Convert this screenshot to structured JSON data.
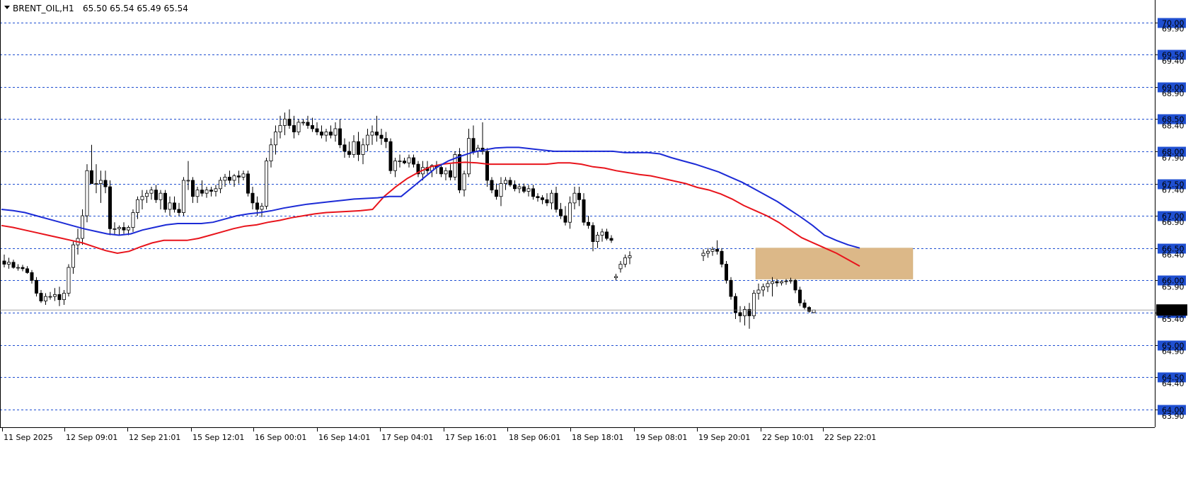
{
  "header": {
    "symbol": "BRENT_OIL,H1",
    "ohlc": "65.50 65.54 65.49 65.54"
  },
  "chart_data": {
    "type": "candlestick",
    "title": "BRENT_OIL,H1  65.50 65.54 65.49 65.54",
    "ylim": [
      63.75,
      70.3
    ],
    "grid": true,
    "grid_style": "dashed",
    "colors": {
      "background": "#ffffff",
      "grid": "#1f4fd1",
      "bull_body": "#ffffff",
      "bear_body": "#000000",
      "wick": "#000000",
      "ma_fast": "#1c2bd6",
      "ma_slow": "#e8141c",
      "zone_fill": "#dcb888",
      "current_price_tag": "#000000"
    },
    "major_levels": [
      "70.00",
      "69.50",
      "69.00",
      "68.50",
      "68.00",
      "67.50",
      "67.00",
      "66.50",
      "66.00",
      "65.50",
      "65.00",
      "64.50",
      "64.00"
    ],
    "minor_levels": [
      "69.90",
      "69.40",
      "68.90",
      "68.40",
      "67.90",
      "67.40",
      "66.90",
      "66.40",
      "65.90",
      "65.40",
      "64.90",
      "64.40",
      "63.90"
    ],
    "current_price": "65.54",
    "x_labels": [
      "11 Sep 2025",
      "12 Sep 09:01",
      "12 Sep 21:01",
      "15 Sep 12:01",
      "16 Sep 00:01",
      "16 Sep 14:01",
      "17 Sep 04:01",
      "17 Sep 16:01",
      "18 Sep 06:01",
      "18 Sep 18:01",
      "19 Sep 08:01",
      "19 Sep 20:01",
      "22 Sep 10:01",
      "22 Sep 22:01"
    ],
    "candles": [
      [
        66.3,
        66.4,
        66.2,
        66.25
      ],
      [
        66.25,
        66.35,
        66.18,
        66.28
      ],
      [
        66.28,
        66.32,
        66.18,
        66.2
      ],
      [
        66.2,
        66.25,
        66.15,
        66.2
      ],
      [
        66.2,
        66.24,
        66.14,
        66.18
      ],
      [
        66.18,
        66.22,
        66.1,
        66.12
      ],
      [
        66.12,
        66.16,
        65.95,
        66.0
      ],
      [
        66.0,
        66.05,
        65.75,
        65.8
      ],
      [
        65.8,
        65.85,
        65.65,
        65.68
      ],
      [
        65.68,
        65.8,
        65.62,
        65.75
      ],
      [
        65.75,
        65.82,
        65.7,
        65.75
      ],
      [
        65.75,
        65.88,
        65.68,
        65.78
      ],
      [
        65.78,
        65.9,
        65.6,
        65.7
      ],
      [
        65.7,
        65.85,
        65.62,
        65.8
      ],
      [
        65.8,
        66.25,
        65.75,
        66.2
      ],
      [
        66.2,
        66.6,
        66.1,
        66.55
      ],
      [
        66.55,
        66.8,
        66.4,
        66.65
      ],
      [
        66.65,
        67.1,
        66.55,
        67.0
      ],
      [
        67.0,
        67.8,
        66.9,
        67.7
      ],
      [
        67.7,
        68.1,
        67.5,
        67.5
      ],
      [
        67.5,
        67.8,
        67.35,
        67.5
      ],
      [
        67.5,
        67.7,
        67.2,
        67.55
      ],
      [
        67.55,
        67.7,
        67.35,
        67.45
      ],
      [
        67.45,
        67.55,
        66.7,
        66.8
      ],
      [
        66.8,
        66.9,
        66.7,
        66.8
      ],
      [
        66.8,
        66.85,
        66.7,
        66.82
      ],
      [
        66.82,
        66.9,
        66.72,
        66.78
      ],
      [
        66.78,
        66.85,
        66.7,
        66.82
      ],
      [
        66.82,
        67.1,
        66.75,
        67.05
      ],
      [
        67.05,
        67.3,
        66.95,
        67.25
      ],
      [
        67.25,
        67.4,
        67.1,
        67.3
      ],
      [
        67.3,
        67.4,
        67.2,
        67.35
      ],
      [
        67.35,
        67.45,
        67.25,
        67.4
      ],
      [
        67.4,
        67.48,
        67.2,
        67.25
      ],
      [
        67.25,
        67.4,
        67.1,
        67.35
      ],
      [
        67.35,
        67.4,
        67.05,
        67.1
      ],
      [
        67.1,
        67.3,
        67.0,
        67.2
      ],
      [
        67.2,
        67.3,
        67.05,
        67.1
      ],
      [
        67.1,
        67.2,
        67.0,
        67.05
      ],
      [
        67.05,
        67.6,
        67.0,
        67.55
      ],
      [
        67.55,
        67.85,
        67.4,
        67.55
      ],
      [
        67.55,
        67.6,
        67.2,
        67.3
      ],
      [
        67.3,
        67.45,
        67.2,
        67.4
      ],
      [
        67.4,
        67.55,
        67.3,
        67.35
      ],
      [
        67.35,
        67.45,
        67.28,
        67.4
      ],
      [
        67.4,
        67.45,
        67.3,
        67.38
      ],
      [
        67.38,
        67.48,
        67.3,
        67.42
      ],
      [
        67.42,
        67.6,
        67.35,
        67.55
      ],
      [
        67.55,
        67.65,
        67.45,
        67.6
      ],
      [
        67.6,
        67.7,
        67.5,
        67.55
      ],
      [
        67.55,
        67.65,
        67.45,
        67.62
      ],
      [
        67.62,
        67.7,
        67.5,
        67.6
      ],
      [
        67.6,
        67.7,
        67.55,
        67.65
      ],
      [
        67.65,
        67.7,
        67.3,
        67.35
      ],
      [
        67.35,
        67.45,
        67.1,
        67.2
      ],
      [
        67.2,
        67.3,
        67.0,
        67.1
      ],
      [
        67.1,
        67.2,
        66.98,
        67.15
      ],
      [
        67.15,
        67.9,
        67.1,
        67.85
      ],
      [
        67.85,
        68.2,
        67.75,
        68.1
      ],
      [
        68.1,
        68.4,
        67.95,
        68.3
      ],
      [
        68.3,
        68.55,
        68.2,
        68.4
      ],
      [
        68.4,
        68.6,
        68.25,
        68.5
      ],
      [
        68.5,
        68.65,
        68.35,
        68.4
      ],
      [
        68.4,
        68.55,
        68.2,
        68.3
      ],
      [
        68.3,
        68.5,
        68.25,
        68.45
      ],
      [
        68.45,
        68.5,
        68.4,
        68.45
      ],
      [
        68.45,
        68.55,
        68.35,
        68.4
      ],
      [
        68.4,
        68.52,
        68.3,
        68.35
      ],
      [
        68.35,
        68.45,
        68.25,
        68.3
      ],
      [
        68.3,
        68.4,
        68.2,
        68.25
      ],
      [
        68.25,
        68.35,
        68.15,
        68.3
      ],
      [
        68.3,
        68.4,
        68.2,
        68.25
      ],
      [
        68.25,
        68.45,
        68.15,
        68.35
      ],
      [
        68.35,
        68.5,
        68.05,
        68.1
      ],
      [
        68.1,
        68.2,
        67.9,
        68.0
      ],
      [
        68.0,
        68.15,
        67.9,
        67.95
      ],
      [
        67.95,
        68.25,
        67.9,
        68.15
      ],
      [
        68.15,
        68.3,
        67.85,
        67.95
      ],
      [
        67.95,
        68.2,
        67.8,
        68.1
      ],
      [
        68.1,
        68.35,
        68.0,
        68.25
      ],
      [
        68.25,
        68.4,
        68.1,
        68.3
      ],
      [
        68.3,
        68.55,
        68.15,
        68.25
      ],
      [
        68.25,
        68.35,
        68.1,
        68.2
      ],
      [
        68.2,
        68.3,
        68.05,
        68.15
      ],
      [
        68.15,
        68.2,
        67.65,
        67.7
      ],
      [
        67.7,
        67.9,
        67.6,
        67.85
      ],
      [
        67.85,
        67.95,
        67.75,
        67.85
      ],
      [
        67.85,
        67.9,
        67.8,
        67.82
      ],
      [
        67.82,
        67.95,
        67.75,
        67.9
      ],
      [
        67.9,
        67.95,
        67.75,
        67.8
      ],
      [
        67.8,
        67.85,
        67.6,
        67.65
      ],
      [
        67.65,
        67.85,
        67.55,
        67.75
      ],
      [
        67.75,
        67.85,
        67.65,
        67.7
      ],
      [
        67.7,
        67.8,
        67.6,
        67.78
      ],
      [
        67.78,
        67.85,
        67.65,
        67.75
      ],
      [
        67.75,
        67.8,
        67.6,
        67.65
      ],
      [
        67.65,
        67.75,
        67.55,
        67.7
      ],
      [
        67.7,
        67.8,
        67.55,
        67.6
      ],
      [
        67.6,
        68.0,
        67.55,
        67.95
      ],
      [
        67.95,
        68.05,
        67.35,
        67.4
      ],
      [
        67.4,
        67.7,
        67.3,
        67.65
      ],
      [
        67.65,
        68.35,
        67.6,
        68.2
      ],
      [
        68.2,
        68.4,
        67.95,
        68.0
      ],
      [
        68.0,
        68.1,
        67.9,
        68.05
      ],
      [
        68.05,
        68.45,
        67.95,
        68.0
      ],
      [
        68.0,
        68.05,
        67.45,
        67.55
      ],
      [
        67.55,
        67.6,
        67.35,
        67.4
      ],
      [
        67.4,
        67.5,
        67.25,
        67.3
      ],
      [
        67.3,
        67.6,
        67.15,
        67.5
      ],
      [
        67.5,
        67.6,
        67.4,
        67.55
      ],
      [
        67.55,
        67.6,
        67.45,
        67.48
      ],
      [
        67.48,
        67.55,
        67.38,
        67.42
      ],
      [
        67.42,
        67.5,
        67.35,
        67.45
      ],
      [
        67.45,
        67.5,
        67.35,
        67.38
      ],
      [
        67.38,
        67.48,
        67.3,
        67.42
      ],
      [
        67.42,
        67.48,
        67.25,
        67.3
      ],
      [
        67.3,
        67.35,
        67.22,
        67.28
      ],
      [
        67.28,
        67.32,
        67.18,
        67.25
      ],
      [
        67.25,
        67.35,
        67.15,
        67.2
      ],
      [
        67.2,
        67.4,
        67.1,
        67.35
      ],
      [
        67.35,
        67.45,
        67.05,
        67.1
      ],
      [
        67.1,
        67.2,
        66.95,
        67.0
      ],
      [
        67.0,
        67.15,
        66.85,
        66.9
      ],
      [
        66.9,
        67.3,
        66.8,
        67.2
      ],
      [
        67.2,
        67.45,
        67.1,
        67.35
      ],
      [
        67.35,
        67.45,
        67.15,
        67.25
      ],
      [
        67.25,
        67.35,
        66.85,
        66.9
      ],
      [
        66.9,
        67.0,
        66.8,
        66.85
      ],
      [
        66.85,
        66.9,
        66.45,
        66.6
      ],
      [
        66.6,
        66.75,
        66.5,
        66.7
      ],
      [
        66.7,
        66.8,
        66.6,
        66.75
      ],
      [
        66.75,
        66.8,
        66.62,
        66.65
      ],
      [
        66.65,
        66.7,
        66.58,
        66.62
      ],
      [
        66.04,
        66.1,
        66.0,
        66.06
      ],
      [
        66.18,
        66.3,
        66.12,
        66.25
      ],
      [
        66.25,
        66.4,
        66.2,
        66.35
      ],
      [
        66.35,
        66.45,
        66.25,
        66.38
      ],
      [
        66.38,
        66.48,
        66.3,
        66.42
      ],
      [
        66.42,
        66.5,
        66.35,
        66.45
      ],
      [
        66.45,
        66.52,
        66.38,
        66.48
      ],
      [
        66.48,
        66.62,
        66.4,
        66.45
      ],
      [
        66.45,
        66.5,
        66.2,
        66.25
      ],
      [
        66.25,
        66.3,
        65.95,
        66.0
      ],
      [
        66.0,
        66.05,
        65.7,
        65.75
      ],
      [
        65.75,
        65.8,
        65.4,
        65.5
      ],
      [
        65.5,
        65.6,
        65.35,
        65.45
      ],
      [
        65.45,
        65.6,
        65.3,
        65.55
      ],
      [
        65.55,
        65.65,
        65.25,
        65.45
      ],
      [
        65.45,
        65.85,
        65.4,
        65.8
      ],
      [
        65.8,
        65.95,
        65.7,
        65.85
      ],
      [
        65.85,
        65.95,
        65.75,
        65.9
      ],
      [
        65.9,
        66.0,
        65.82,
        65.95
      ],
      [
        65.95,
        66.05,
        65.75,
        65.98
      ],
      [
        65.98,
        66.02,
        65.9,
        65.96
      ],
      [
        65.96,
        66.0,
        65.92,
        65.98
      ],
      [
        65.98,
        66.02,
        65.93,
        65.99
      ],
      [
        65.99,
        66.04,
        65.95,
        66.0
      ],
      [
        66.0,
        66.02,
        65.8,
        65.85
      ],
      [
        65.85,
        65.9,
        65.6,
        65.65
      ],
      [
        65.65,
        65.7,
        65.55,
        65.58
      ],
      [
        65.58,
        65.6,
        65.5,
        65.52
      ],
      [
        65.5,
        65.54,
        65.49,
        65.54
      ]
    ],
    "ma_fast": [
      67.1,
      67.08,
      67.05,
      67.0,
      66.95,
      66.9,
      66.85,
      66.8,
      66.76,
      66.72,
      66.7,
      66.72,
      66.78,
      66.82,
      66.86,
      66.88,
      66.88,
      66.88,
      66.9,
      66.95,
      67.0,
      67.03,
      67.05,
      67.08,
      67.12,
      67.15,
      67.18,
      67.2,
      67.22,
      67.24,
      67.26,
      67.27,
      67.28,
      67.3,
      67.3,
      67.45,
      67.6,
      67.75,
      67.85,
      67.92,
      67.98,
      68.02,
      68.05,
      68.06,
      68.06,
      68.04,
      68.02,
      68.0,
      68.0,
      68.0,
      68.0,
      68.0,
      68.0,
      67.98,
      67.98,
      67.98,
      67.96,
      67.9,
      67.85,
      67.8,
      67.74,
      67.68,
      67.6,
      67.52,
      67.42,
      67.32,
      67.22,
      67.1,
      66.98,
      66.85,
      66.7,
      66.62,
      66.55,
      66.5
    ],
    "ma_slow": [
      66.85,
      66.82,
      66.78,
      66.74,
      66.7,
      66.66,
      66.62,
      66.58,
      66.52,
      66.46,
      66.42,
      66.45,
      66.52,
      66.58,
      66.62,
      66.62,
      66.62,
      66.65,
      66.7,
      66.75,
      66.8,
      66.84,
      66.86,
      66.9,
      66.93,
      66.97,
      67.0,
      67.03,
      67.05,
      67.06,
      67.07,
      67.08,
      67.1,
      67.3,
      67.45,
      67.58,
      67.68,
      67.76,
      67.8,
      67.82,
      67.83,
      67.82,
      67.8,
      67.8,
      67.8,
      67.8,
      67.8,
      67.8,
      67.82,
      67.82,
      67.8,
      67.76,
      67.74,
      67.7,
      67.67,
      67.64,
      67.62,
      67.58,
      67.54,
      67.5,
      67.44,
      67.4,
      67.34,
      67.26,
      67.16,
      67.08,
      67.0,
      66.9,
      66.78,
      66.66,
      66.58,
      66.5,
      66.42,
      66.32,
      66.22
    ],
    "zone": {
      "top": 66.5,
      "bottom": 66.02
    }
  }
}
